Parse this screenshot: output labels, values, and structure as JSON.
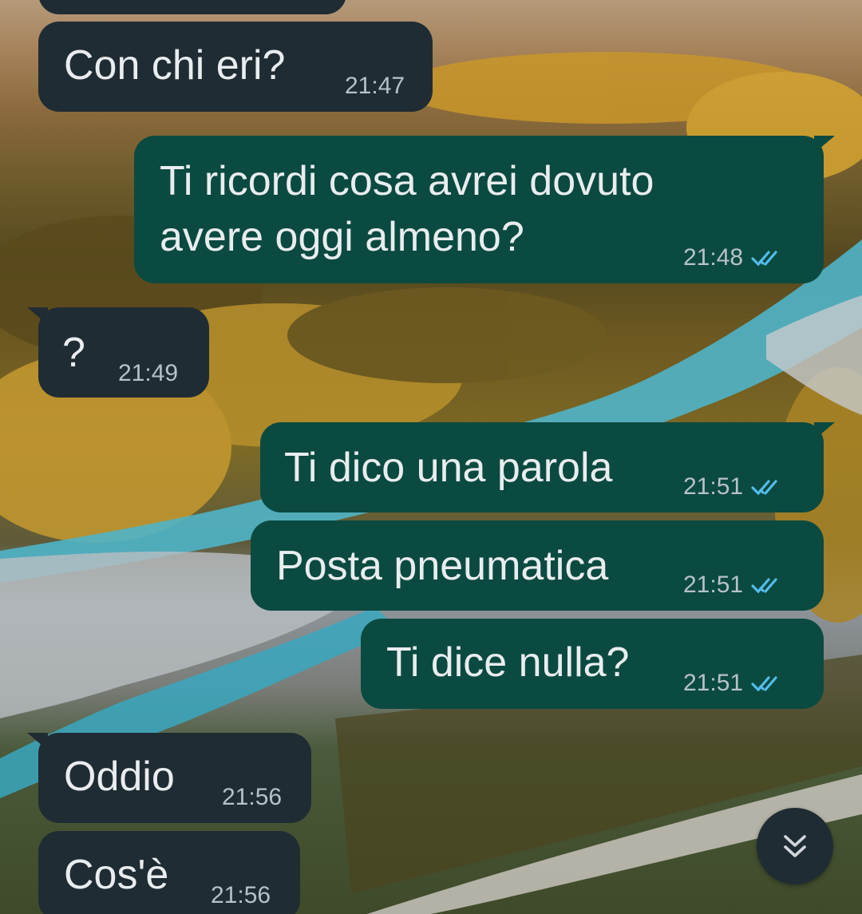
{
  "colors": {
    "incoming_bubble": "#202c33",
    "outgoing_bubble": "#0b4a40",
    "text": "#e9edef",
    "timestamp": "#b7c2c8",
    "read_tick": "#53bdeb"
  },
  "messages": [
    {
      "direction": "in",
      "text": "Con chi eri?",
      "time": "21:47"
    },
    {
      "direction": "out",
      "lines": [
        "Ti ricordi cosa avrei dovuto",
        "avere oggi almeno?"
      ],
      "time": "21:48",
      "status": "read"
    },
    {
      "direction": "in",
      "text": "?",
      "time": "21:49"
    },
    {
      "direction": "out",
      "text": "Ti dico una parola",
      "time": "21:51",
      "status": "read"
    },
    {
      "direction": "out",
      "text": "Posta pneumatica",
      "time": "21:51",
      "status": "read"
    },
    {
      "direction": "out",
      "text": "Ti dice nulla?",
      "time": "21:51",
      "status": "read"
    },
    {
      "direction": "in",
      "text": "Oddio",
      "time": "21:56"
    },
    {
      "direction": "in",
      "text": "Cos'è",
      "time": "21:56"
    }
  ],
  "scroll_button": {
    "icon": "double-chevron-down-icon"
  },
  "wallpaper": {
    "icon": "autumn-valley-wallpaper"
  }
}
